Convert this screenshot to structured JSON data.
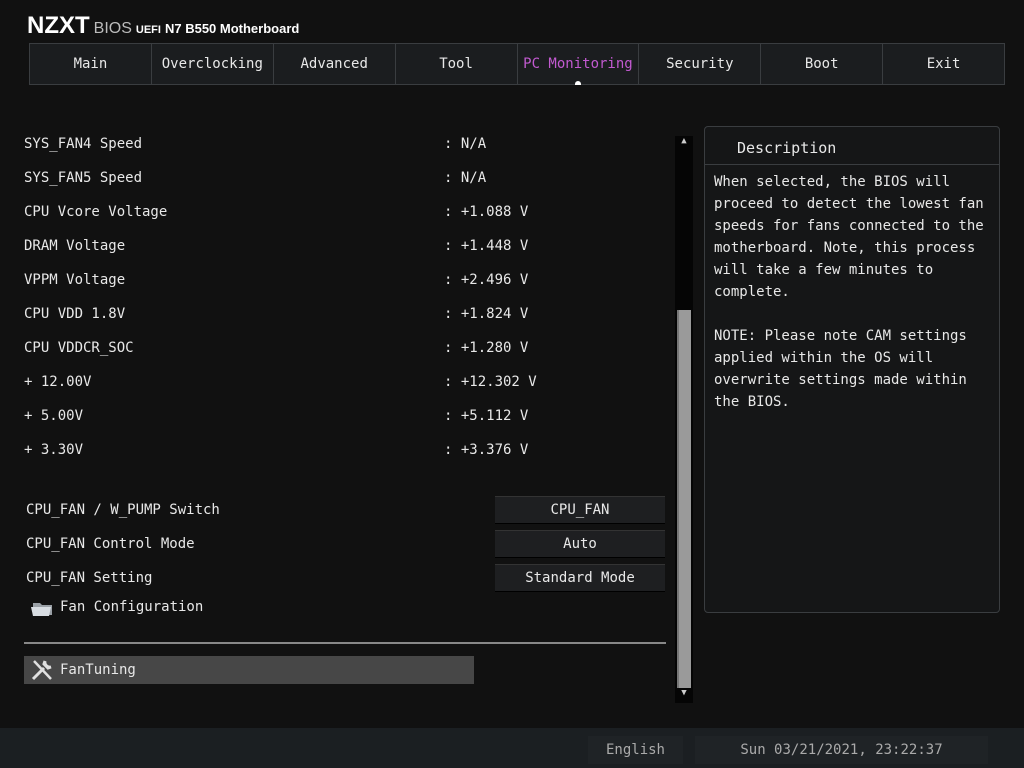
{
  "header": {
    "brand": "NZXT",
    "bios": "BIOS",
    "uefi": "UEFI",
    "model": "N7 B550 Motherboard"
  },
  "tabs": [
    "Main",
    "Overclocking",
    "Advanced",
    "Tool",
    "PC Monitoring",
    "Security",
    "Boot",
    "Exit"
  ],
  "active_tab": "PC Monitoring",
  "readings": [
    {
      "label": "SYS_FAN4 Speed",
      "value": ": N/A"
    },
    {
      "label": "SYS_FAN5 Speed",
      "value": ": N/A"
    },
    {
      "label": "CPU Vcore Voltage",
      "value": ": +1.088 V"
    },
    {
      "label": "DRAM Voltage",
      "value": ": +1.448 V"
    },
    {
      "label": "VPPM Voltage",
      "value": ": +2.496 V"
    },
    {
      "label": "CPU VDD 1.8V",
      "value": ": +1.824 V"
    },
    {
      "label": "CPU VDDCR_SOC",
      "value": ": +1.280 V"
    },
    {
      "label": "+ 12.00V",
      "value": ": +12.302 V"
    },
    {
      "label": "+ 5.00V",
      "value": ": +5.112 V"
    },
    {
      "label": "+ 3.30V",
      "value": ": +3.376 V"
    }
  ],
  "options": [
    {
      "label": "CPU_FAN / W_PUMP Switch",
      "value": "CPU_FAN"
    },
    {
      "label": "CPU_FAN Control Mode",
      "value": "Auto"
    },
    {
      "label": "CPU_FAN Setting",
      "value": "Standard Mode"
    }
  ],
  "fan_configuration": "Fan Configuration",
  "fantuning": "FanTuning",
  "description": {
    "title": "Description",
    "text": "When selected, the BIOS will\nproceed to detect the lowest fan\nspeeds for fans connected to the\nmotherboard. Note, this process\nwill take a few minutes to\ncomplete.\n\nNOTE: Please note CAM settings\napplied within the OS will\noverwrite settings made within\nthe BIOS."
  },
  "footer": {
    "language": "English",
    "datetime": "Sun 03/21/2021, 23:22:37"
  }
}
